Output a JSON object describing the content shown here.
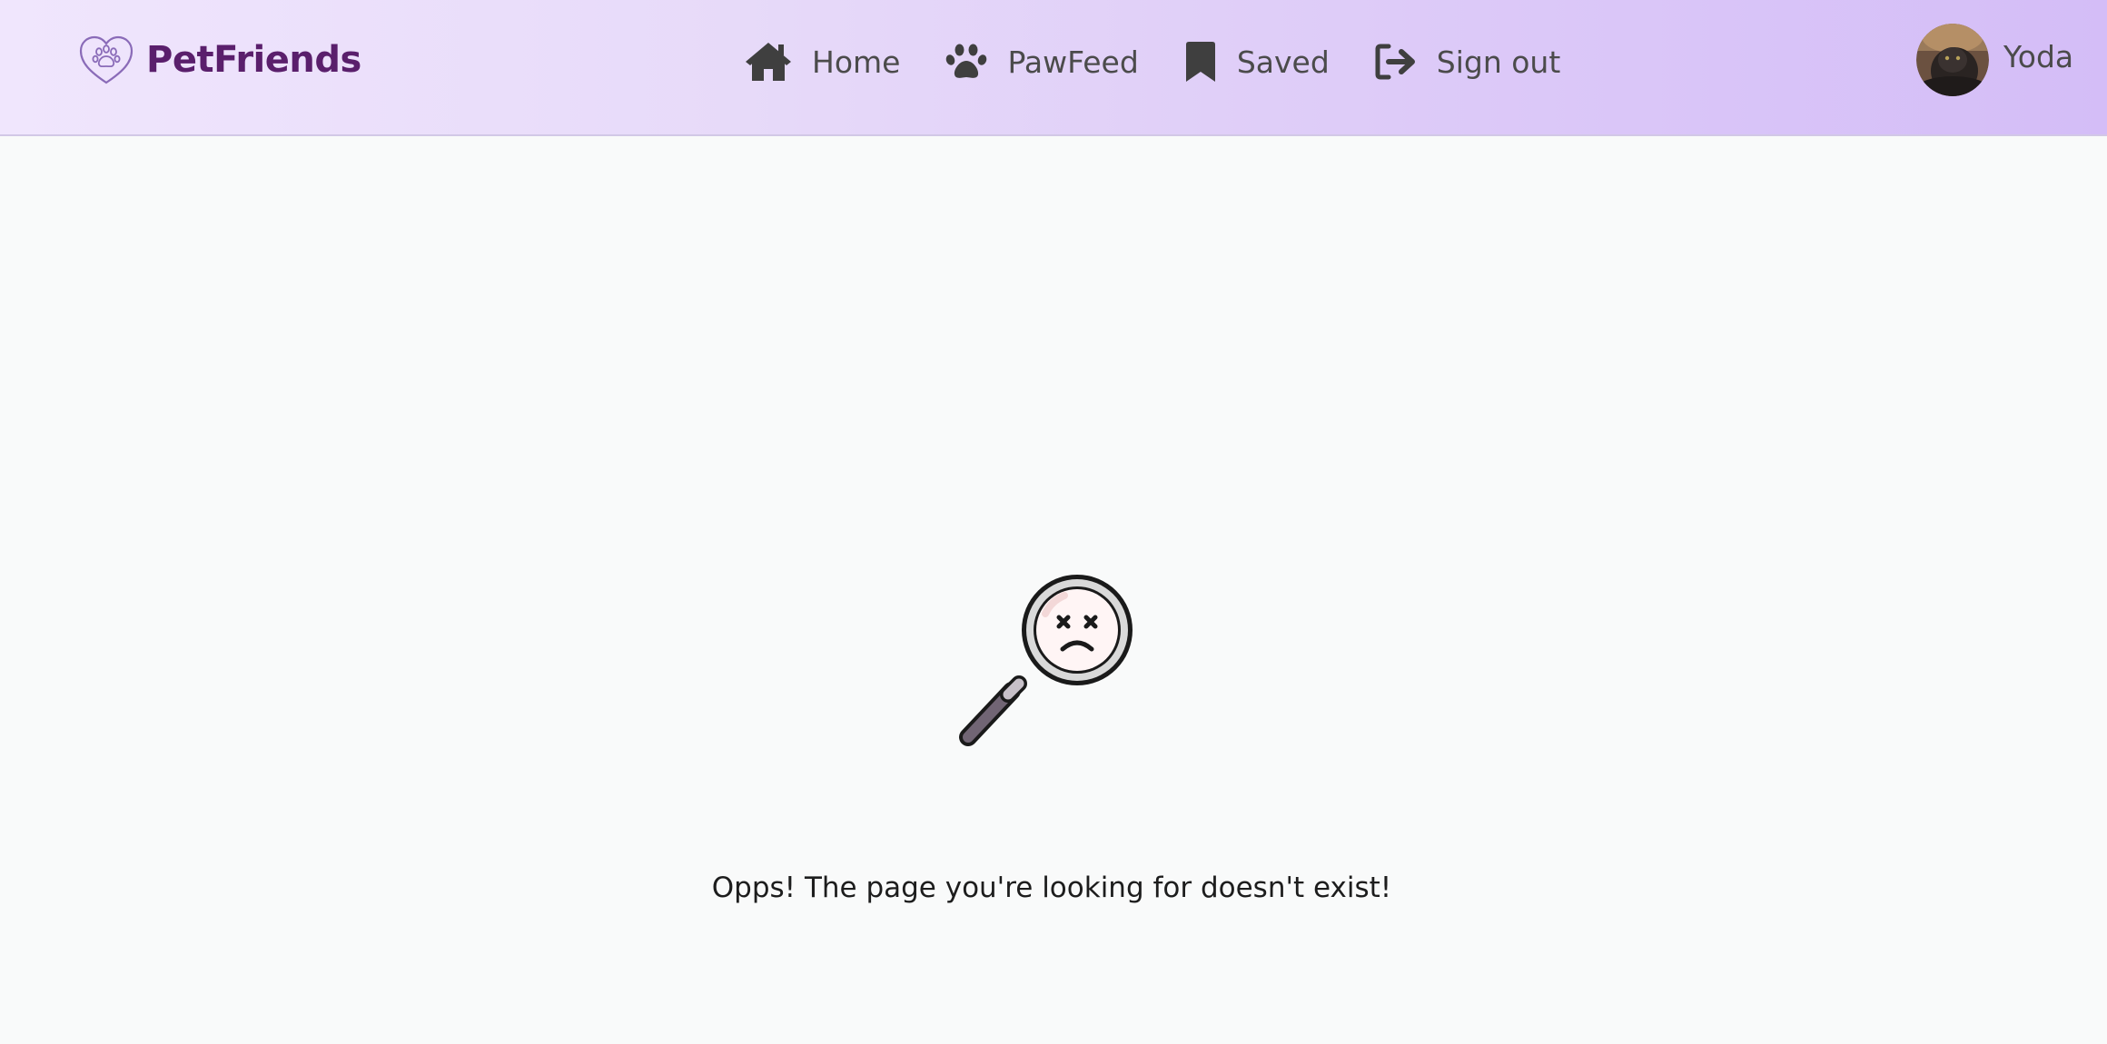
{
  "brand": {
    "name": "PetFriends",
    "logo_icon": "heart-paw-icon"
  },
  "nav": {
    "items": [
      {
        "label": "Home",
        "icon": "home-icon"
      },
      {
        "label": "PawFeed",
        "icon": "paw-icon"
      },
      {
        "label": "Saved",
        "icon": "bookmark-icon"
      },
      {
        "label": "Sign out",
        "icon": "sign-out-icon"
      }
    ]
  },
  "user": {
    "name": "Yoda",
    "avatar": "avatar-photo"
  },
  "not_found": {
    "illustration": "sad-magnifier-icon",
    "message": "Opps! The page you're looking for doesn't exist!"
  },
  "colors": {
    "brand": "#5a1f6c",
    "nav_text": "#4b4b4b",
    "icon": "#3f3f3f",
    "page_background": "#f9fafa",
    "header_gradient_start": "#f0e6fd",
    "header_gradient_end": "#d4bdf7"
  }
}
